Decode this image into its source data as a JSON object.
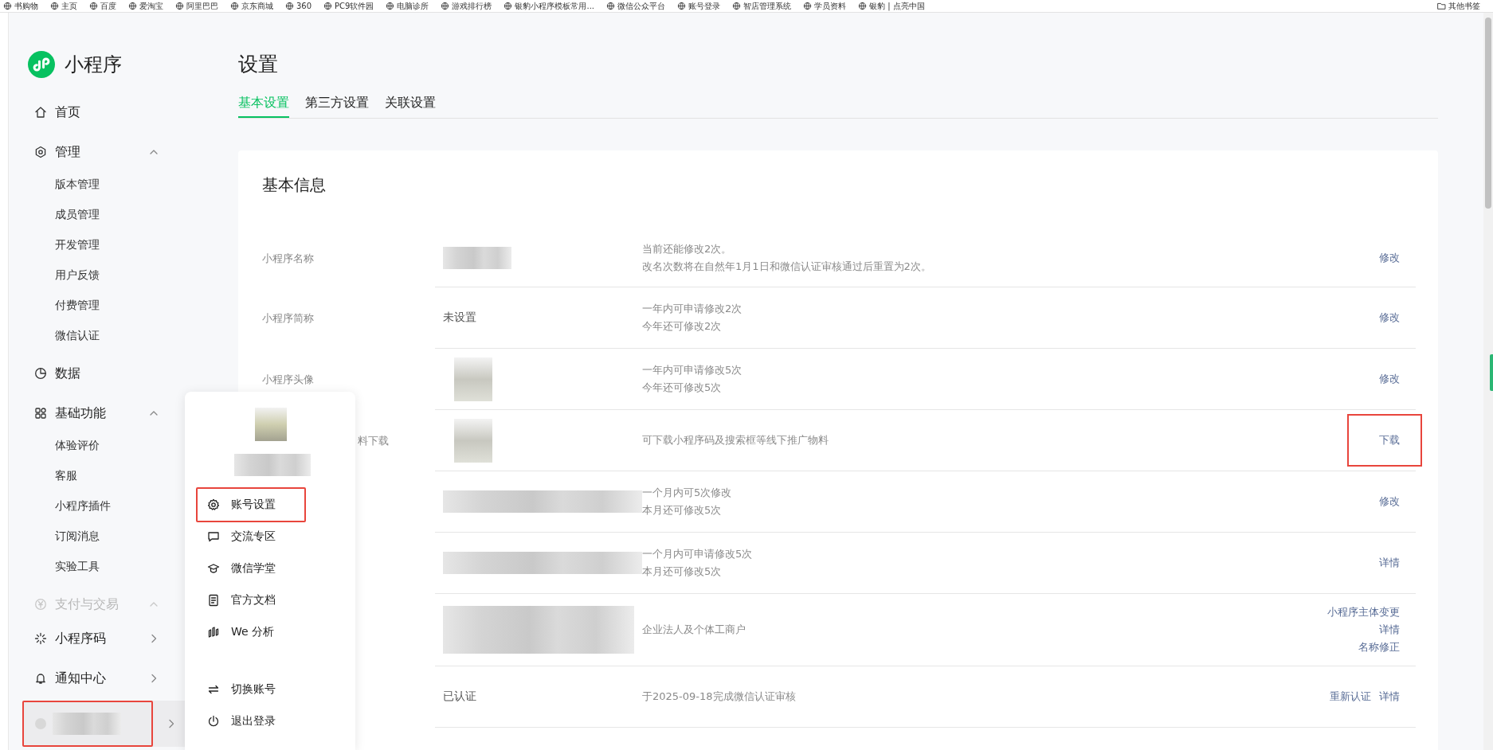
{
  "bookmarks": {
    "items": [
      "书购物",
      "主页",
      "百度",
      "爱淘宝",
      "阿里巴巴",
      "京东商城",
      "360",
      "PC9软件园",
      "电脑诊所",
      "游戏排行榜",
      "银豹小程序模板常用...",
      "微信公众平台",
      "账号登录",
      "智店管理系统",
      "学员资料",
      "银豹 | 点亮中国"
    ],
    "other": "其他书签"
  },
  "sidebar": {
    "app_name": "小程序",
    "items": [
      {
        "label": "首页"
      },
      {
        "label": "管理",
        "expanded": true,
        "children": [
          {
            "label": "版本管理"
          },
          {
            "label": "成员管理"
          },
          {
            "label": "开发管理"
          },
          {
            "label": "用户反馈"
          },
          {
            "label": "付费管理"
          },
          {
            "label": "微信认证"
          }
        ]
      },
      {
        "label": "数据"
      },
      {
        "label": "基础功能",
        "expanded": true,
        "children": [
          {
            "label": "体验评价"
          },
          {
            "label": "客服"
          },
          {
            "label": "小程序插件"
          },
          {
            "label": "订阅消息"
          },
          {
            "label": "实验工具"
          }
        ]
      },
      {
        "label": "支付与交易",
        "expanded": true,
        "dimmed": true
      }
    ],
    "bottom_items": [
      {
        "label": "小程序码",
        "expanded": false
      },
      {
        "label": "通知中心",
        "expanded": false
      }
    ],
    "account": {
      "highlighted": true
    }
  },
  "account_menu": {
    "items": [
      {
        "label": "账号设置",
        "highlighted": true
      },
      {
        "label": "交流专区",
        "highlighted": false
      },
      {
        "label": "微信学堂",
        "highlighted": false
      },
      {
        "label": "官方文档",
        "highlighted": false
      },
      {
        "label": "We 分析",
        "highlighted": false
      }
    ],
    "footer_items": [
      {
        "label": "切换账号"
      },
      {
        "label": "退出登录"
      }
    ]
  },
  "page": {
    "title": "设置",
    "tabs": [
      {
        "label": "基本设置",
        "selected": true
      },
      {
        "label": "第三方设置",
        "selected": false
      },
      {
        "label": "关联设置",
        "selected": false
      }
    ],
    "card": {
      "title": "基本信息",
      "rows": [
        {
          "label": "小程序名称",
          "value": {
            "kind": "blurred_text"
          },
          "description": [
            "当前还能修改2次。",
            "改名次数将在自然年1月1日和微信认证审核通过后重置为2次。"
          ],
          "actions": [
            "修改"
          ],
          "highlighted": false
        },
        {
          "label": "小程序简称",
          "value": {
            "kind": "text",
            "text": "未设置"
          },
          "description": [
            "一年内可申请修改2次",
            "今年还可修改2次"
          ],
          "actions": [
            "修改"
          ],
          "highlighted": false
        },
        {
          "label": "小程序头像",
          "value": {
            "kind": "blurred_image"
          },
          "description": [
            "一年内可申请修改5次",
            "今年还可修改5次"
          ],
          "actions": [
            "修改"
          ],
          "highlighted": false
        },
        {
          "label": "料下载",
          "label_clipped": true,
          "value": {
            "kind": "blurred_image"
          },
          "description": [
            "可下载小程序码及搜索框等线下推广物料"
          ],
          "actions": [
            "下载"
          ],
          "highlighted": true
        },
        {
          "value": {
            "kind": "blurred_text"
          },
          "description": [
            "一个月内可5次修改",
            "本月还可修改5次"
          ],
          "actions": [
            "修改"
          ],
          "highlighted": false
        },
        {
          "value": {
            "kind": "blurred_text"
          },
          "description": [
            "一个月内可申请修改5次",
            "本月还可修改5次"
          ],
          "actions": [
            "详情"
          ],
          "highlighted": false
        },
        {
          "value": {
            "kind": "blurred_text"
          },
          "description": [
            "企业法人及个体工商户"
          ],
          "actions": [
            "小程序主体变更",
            "详情",
            "名称修正"
          ],
          "highlighted": false
        },
        {
          "value": {
            "kind": "text",
            "text": "已认证"
          },
          "description": [
            "于2025-09-18完成微信认证审核"
          ],
          "actions": [
            "重新认证",
            "详情"
          ],
          "highlighted": false
        }
      ]
    }
  }
}
